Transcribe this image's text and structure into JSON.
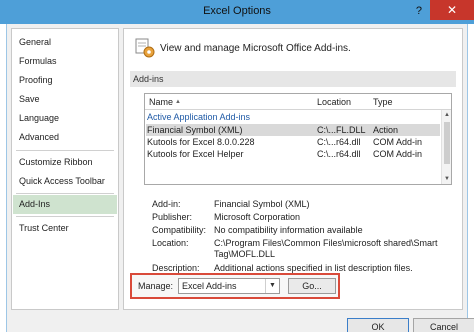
{
  "window": {
    "title": "Excel Options",
    "help_label": "?",
    "close_label": "✕"
  },
  "sidebar": {
    "items": [
      {
        "label": "General"
      },
      {
        "label": "Formulas"
      },
      {
        "label": "Proofing"
      },
      {
        "label": "Save"
      },
      {
        "label": "Language"
      },
      {
        "label": "Advanced"
      },
      {
        "label": "Customize Ribbon"
      },
      {
        "label": "Quick Access Toolbar"
      },
      {
        "label": "Add-Ins"
      },
      {
        "label": "Trust Center"
      }
    ],
    "selected_index": 8
  },
  "main": {
    "header_text": "View and manage Microsoft Office Add-ins.",
    "section_label": "Add-ins",
    "list": {
      "columns": [
        "Name",
        "Location",
        "Type"
      ],
      "sort_indicator": "▲",
      "group_label": "Active Application Add-ins",
      "rows": [
        {
          "name": "Financial Symbol (XML)",
          "location": "C:\\...FL.DLL",
          "type": "Action",
          "selected": true
        },
        {
          "name": "Kutools for Excel 8.0.0.228",
          "location": "C:\\...r64.dll",
          "type": "COM Add-in"
        },
        {
          "name": "Kutools for Excel  Helper",
          "location": "C:\\...r64.dll",
          "type": "COM Add-in"
        }
      ]
    },
    "details": {
      "addin_label": "Add-in:",
      "addin_value": "Financial Symbol (XML)",
      "publisher_label": "Publisher:",
      "publisher_value": "Microsoft Corporation",
      "compat_label": "Compatibility:",
      "compat_value": "No compatibility information available",
      "location_label": "Location:",
      "location_value": "C:\\Program Files\\Common Files\\microsoft shared\\Smart Tag\\MOFL.DLL",
      "description_label": "Description:",
      "description_value": "Additional actions specified in list description files."
    },
    "manage": {
      "label": "Manage:",
      "selected": "Excel Add-ins",
      "go_label": "Go..."
    }
  },
  "footer": {
    "ok_label": "OK",
    "cancel_label": "Cancel"
  },
  "colors": {
    "titlebar": "#4e9fd8",
    "close": "#c7362b",
    "highlight": "#d94a3a",
    "selected_nav": "#cfe3cf"
  }
}
